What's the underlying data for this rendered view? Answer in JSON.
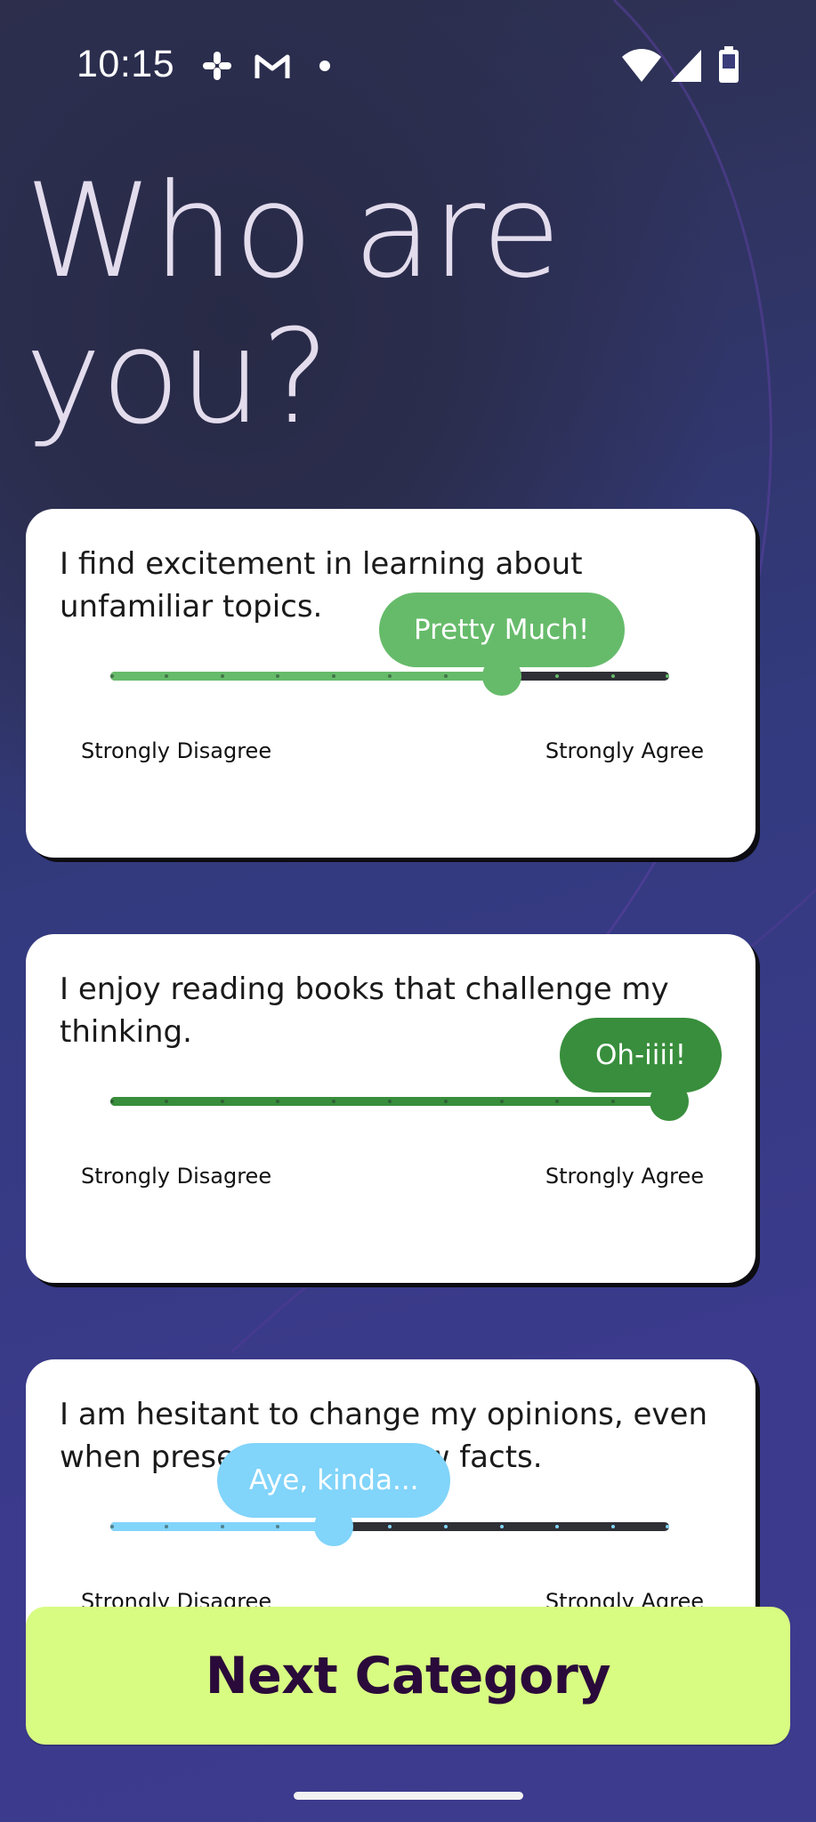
{
  "status_bar": {
    "time": "10:15",
    "left_icons": [
      "slack-icon",
      "gmail-icon",
      "notification-dot-icon"
    ],
    "right_icons": [
      "wifi-icon",
      "cellular-signal-icon",
      "battery-icon"
    ]
  },
  "page": {
    "title": "Who are you?"
  },
  "questions": [
    {
      "text": "I find excitement in learning about unfamiliar topics.",
      "response_label": "Pretty Much!",
      "value": 0.7,
      "color": "#66bb6a",
      "min_label": "Strongly Disagree",
      "max_label": "Strongly Agree"
    },
    {
      "text": "I enjoy reading books that challenge my thinking.",
      "response_label": "Oh-iiii!",
      "value": 1.0,
      "color": "#388e3c",
      "min_label": "Strongly Disagree",
      "max_label": "Strongly Agree"
    },
    {
      "text": "I am hesitant to change my opinions, even when presented with new facts.",
      "response_label": "Aye, kinda...",
      "value": 0.4,
      "color": "#81d4fa",
      "min_label": "Strongly Disagree",
      "max_label": "Strongly Agree"
    }
  ],
  "footer": {
    "next_button_label": "Next Category"
  },
  "colors": {
    "background": "#3b3a8c",
    "title_text": "#e3dced",
    "button_background": "#d8fb82",
    "button_text": "#2a0a3a"
  }
}
